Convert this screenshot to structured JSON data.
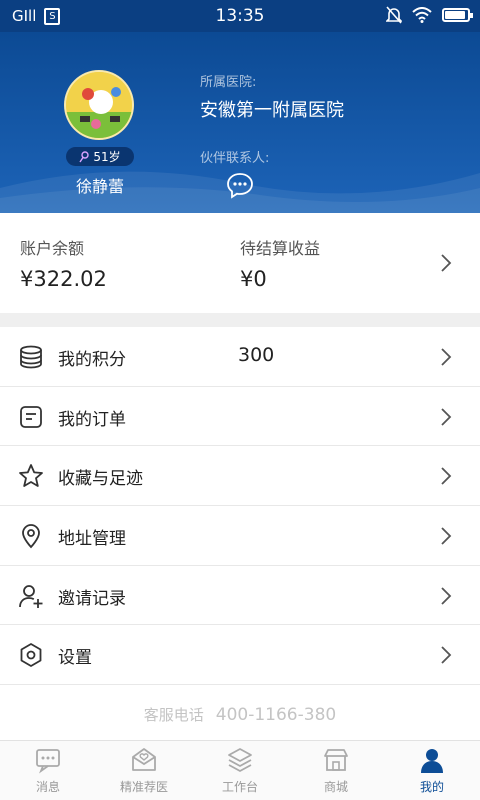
{
  "status_bar": {
    "signal": "GIll",
    "sim": "S",
    "time": "13:35",
    "battery_level": 0.85
  },
  "profile": {
    "age": "51岁",
    "name": "徐静蕾",
    "hospital_label": "所属医院:",
    "hospital_name": "安徽第一附属医院",
    "partner_label": "伙伴联系人:"
  },
  "balance": {
    "account_label": "账户余额",
    "account_value": "¥322.02",
    "pending_label": "待结算收益",
    "pending_value": "¥0"
  },
  "menu": {
    "items": [
      {
        "label": "我的积分",
        "value": "300",
        "icon": "coins-icon"
      },
      {
        "label": "我的订单",
        "value": "",
        "icon": "order-icon"
      },
      {
        "label": "收藏与足迹",
        "value": "",
        "icon": "star-icon"
      },
      {
        "label": "地址管理",
        "value": "",
        "icon": "location-icon"
      },
      {
        "label": "邀请记录",
        "value": "",
        "icon": "invite-user-icon"
      },
      {
        "label": "设置",
        "value": "",
        "icon": "settings-icon"
      }
    ]
  },
  "service": {
    "label": "客服电话",
    "phone": "400-1166-380"
  },
  "tabbar": {
    "items": [
      {
        "label": "消息",
        "icon": "message-icon",
        "active": false
      },
      {
        "label": "精准荐医",
        "icon": "doctor-recommend-icon",
        "active": false
      },
      {
        "label": "工作台",
        "icon": "workbench-icon",
        "active": false
      },
      {
        "label": "商城",
        "icon": "shop-icon",
        "active": false
      },
      {
        "label": "我的",
        "icon": "user-icon",
        "active": true
      }
    ]
  },
  "colors": {
    "header_blue": "#0c4a94",
    "active_tab": "#0d4d96",
    "inactive_tab": "#999999"
  }
}
